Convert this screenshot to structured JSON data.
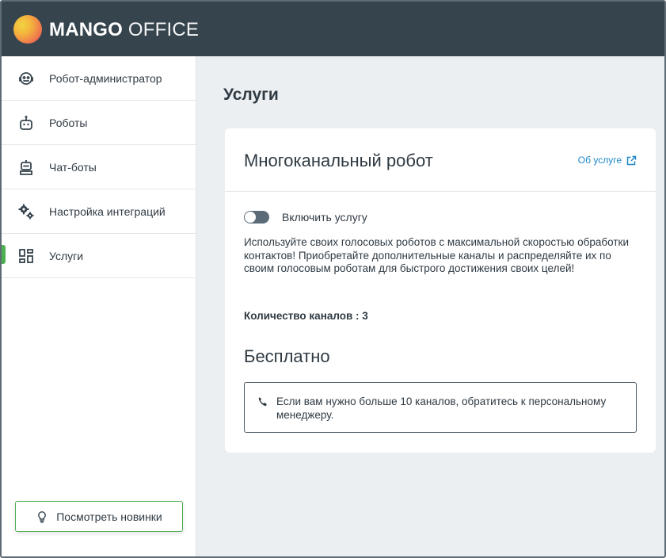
{
  "brand": {
    "logo_bold": "MANGO",
    "logo_light": " OFFICE"
  },
  "sidebar": {
    "items": [
      {
        "label": "Робот-администратор",
        "icon": "robot-admin-icon"
      },
      {
        "label": "Роботы",
        "icon": "robot-icon"
      },
      {
        "label": "Чат-боты",
        "icon": "chatbot-icon"
      },
      {
        "label": "Настройка интеграций",
        "icon": "gears-icon"
      },
      {
        "label": "Услуги",
        "icon": "services-grid-icon"
      }
    ],
    "active_item": "Услуги",
    "news_button": "Посмотреть новинки"
  },
  "main": {
    "page_title": "Услуги",
    "card": {
      "title": "Многоканальный робот",
      "about_link": "Об услуге",
      "toggle_label": "Включить услугу",
      "toggle_on": false,
      "description": "Используйте своих голосовых роботов с максимальной скоростью обработки контактов! Приобретайте дополнительные каналы и распределяйте их по своим голосовым роботам для быстрого достижения своих целей!",
      "channels": "Количество каналов : 3",
      "price": "Бесплатно",
      "note": "Если вам нужно больше 10 каналов, обратитесь к персональному менеджеру."
    }
  },
  "colors": {
    "header_bg": "#36444d",
    "accent_green": "#4caf50",
    "link_blue": "#1f86c9",
    "page_bg": "#eceff2"
  }
}
